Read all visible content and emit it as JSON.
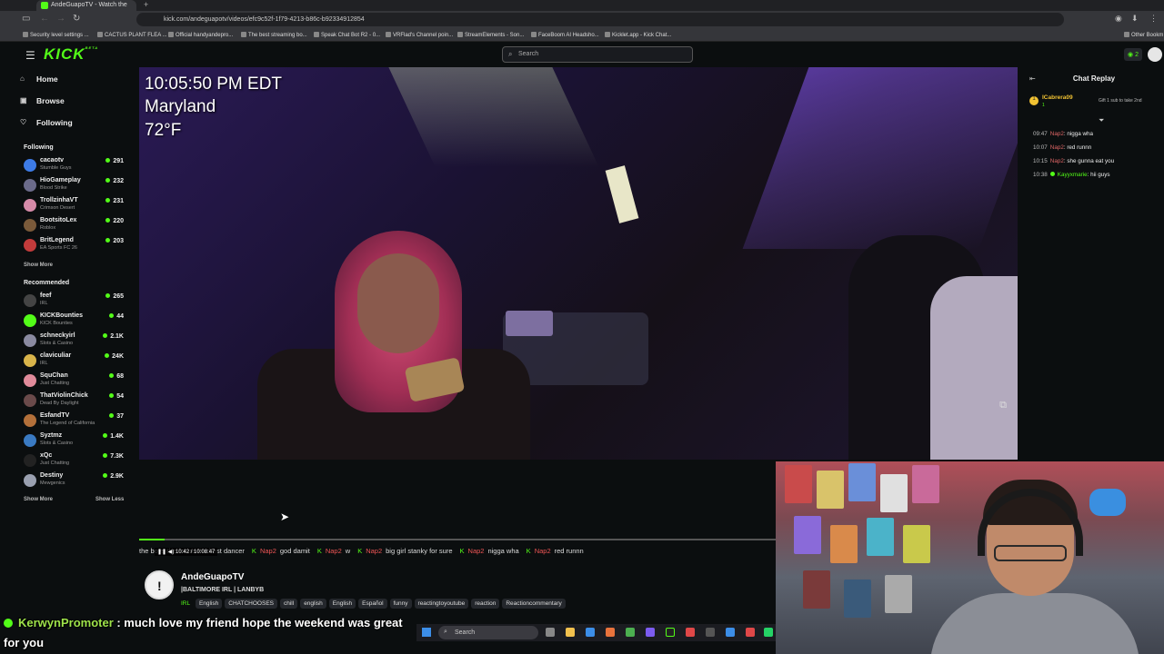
{
  "browser": {
    "tab_title": "AndeGuapoTV - Watch the",
    "url": "kick.com/andeguapotv/videos/efc9c52f-1f79-4213-b86c-b92334912854",
    "bookmarks": [
      "Security level settings ...",
      "CACTUS PLANT FLEA ...",
      "Official handyandepro...",
      "The best streaming bo...",
      "Speak Chat Bot R2 - 0...",
      "VRFlad's Channel poin...",
      "StreamElements - Son...",
      "FaceBoom AI Headsho...",
      "Kicklet.app - Kick Chat..."
    ],
    "other_bookmarks": "Other Bookm"
  },
  "header": {
    "logo": "KICK",
    "logo_beta": "BETA",
    "search_placeholder": "Search",
    "notif_count": "2"
  },
  "sidebar": {
    "nav": [
      {
        "label": "Home"
      },
      {
        "label": "Browse"
      },
      {
        "label": "Following"
      }
    ],
    "following_title": "Following",
    "following": [
      {
        "name": "cacaotv",
        "category": "Stumble Guys",
        "viewers": "291",
        "color": "#3d7be6"
      },
      {
        "name": "HioGameplay",
        "category": "Blood Strike",
        "viewers": "232",
        "color": "#6b6b8a"
      },
      {
        "name": "TrollzinhaVT",
        "category": "Crimson Desert",
        "viewers": "231",
        "color": "#d58aa8"
      },
      {
        "name": "BootsitoLex",
        "category": "Roblox",
        "viewers": "220",
        "color": "#7a5a3a"
      },
      {
        "name": "BritLegend",
        "category": "EA Sports FC 26",
        "viewers": "203",
        "color": "#c23b3b"
      }
    ],
    "show_more": "Show More",
    "recommended_title": "Recommended",
    "recommended": [
      {
        "name": "feef",
        "category": "IRL",
        "viewers": "265",
        "color": "#444"
      },
      {
        "name": "KICKBounties",
        "category": "KICK Bounties",
        "viewers": "44",
        "color": "#53fc18"
      },
      {
        "name": "schneckyirl",
        "category": "Slots & Casino",
        "viewers": "2.1K",
        "color": "#8a8aa0"
      },
      {
        "name": "claviculiar",
        "category": "IRL",
        "viewers": "24K",
        "color": "#d9b44a"
      },
      {
        "name": "SquChan",
        "category": "Just Chatting",
        "viewers": "68",
        "color": "#e08a9a"
      },
      {
        "name": "ThatViolinChick",
        "category": "Dead By Daylight",
        "viewers": "54",
        "color": "#6a4a4a"
      },
      {
        "name": "EsfandTV",
        "category": "The Legend of California",
        "viewers": "37",
        "color": "#b3703a"
      },
      {
        "name": "Syztmz",
        "category": "Slots & Casino",
        "viewers": "1.4K",
        "color": "#3a7ac2"
      },
      {
        "name": "xQc",
        "category": "Just Chatting",
        "viewers": "7.3K",
        "color": "#222"
      },
      {
        "name": "Destiny",
        "category": "Mewgenics",
        "viewers": "2.9K",
        "color": "#9aa0b0"
      }
    ],
    "show_less": "Show Less"
  },
  "video": {
    "time": "10:05:50 PM EDT",
    "location": "Maryland",
    "temp": "72°F",
    "progress": 0.04,
    "timestamp": "10:42 / 10:08:47"
  },
  "ticker": [
    {
      "user": "",
      "text": "the boys the future the best dancer"
    },
    {
      "user": "Nap2",
      "text": "god damit"
    },
    {
      "user": "Nap2",
      "text": "w"
    },
    {
      "user": "Nap2",
      "text": "big girl stanky for sure"
    },
    {
      "user": "Nap2",
      "text": "nigga wha"
    },
    {
      "user": "Nap2",
      "text": "red runnn"
    }
  ],
  "stream": {
    "channel": "AndeGuapoTV",
    "title": "|BALTIMORE IRL | LANBYB",
    "category": "IRL",
    "tags": [
      "English",
      "CHATCHOOSES",
      "chill",
      "english",
      "English",
      "Español",
      "funny",
      "reactingtoyoutube",
      "reaction",
      "Reactioncommentary"
    ]
  },
  "chat": {
    "title": "Chat Replay",
    "gift_user": "ICabrera09",
    "gift_count": "1",
    "gift_text": "Gift 1 sub to take 2nd",
    "messages": [
      {
        "time": "09:47",
        "user": "Nap2",
        "text": "nigga wha",
        "green": false
      },
      {
        "time": "10:07",
        "user": "Nap2",
        "text": "red runnn",
        "green": false
      },
      {
        "time": "10:15",
        "user": "Nap2",
        "text": "she gunna eat you",
        "green": false
      },
      {
        "time": "10:38",
        "user": "Kayyxmarie",
        "text": "hii guys",
        "green": true
      }
    ]
  },
  "overlay_chat": {
    "user": "KerwynPromoter",
    "line1": " : much love my friend hope the weekend was great",
    "line2": "for you"
  },
  "taskbar": {
    "search": "Search"
  }
}
